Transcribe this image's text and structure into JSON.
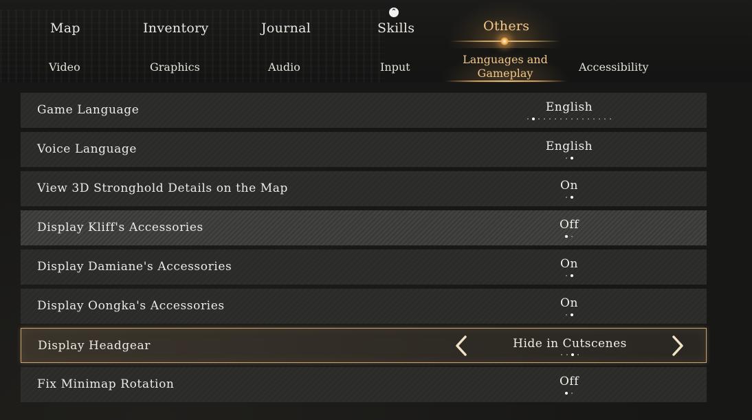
{
  "top_tabs": [
    {
      "label": "Map"
    },
    {
      "label": "Inventory"
    },
    {
      "label": "Journal"
    },
    {
      "label": "Skills"
    },
    {
      "label": "Others"
    }
  ],
  "active_top_tab": "Others",
  "sub_tabs": [
    {
      "label": "Video"
    },
    {
      "label": "Graphics"
    },
    {
      "label": "Audio"
    },
    {
      "label": "Input"
    },
    {
      "label": "Languages and Gameplay"
    },
    {
      "label": "Accessibility"
    }
  ],
  "active_sub_tab": "Languages and Gameplay",
  "settings": [
    {
      "label": "Game Language",
      "value": "English",
      "options_count": 16,
      "selected_index": 1
    },
    {
      "label": "Voice Language",
      "value": "English",
      "options_count": 2,
      "selected_index": 1
    },
    {
      "label": "View 3D Stronghold Details on the Map",
      "value": "On",
      "options_count": 2,
      "selected_index": 1
    },
    {
      "label": "Display Kliff's Accessories",
      "value": "Off",
      "options_count": 2,
      "selected_index": 0
    },
    {
      "label": "Display Damiane's Accessories",
      "value": "On",
      "options_count": 2,
      "selected_index": 1
    },
    {
      "label": "Display Oongka's Accessories",
      "value": "On",
      "options_count": 2,
      "selected_index": 1
    },
    {
      "label": "Display Headgear",
      "value": "Hide in Cutscenes",
      "options_count": 4,
      "selected_index": 2
    },
    {
      "label": "Fix Minimap Rotation",
      "value": "Off",
      "options_count": 2,
      "selected_index": 0
    }
  ],
  "hovered_row": "Display Kliff's Accessories",
  "selected_row": "Display Headgear",
  "colors": {
    "accent": "#f3c98a",
    "row_bg": "#2b2b2a",
    "selected_border": "#caa574"
  }
}
